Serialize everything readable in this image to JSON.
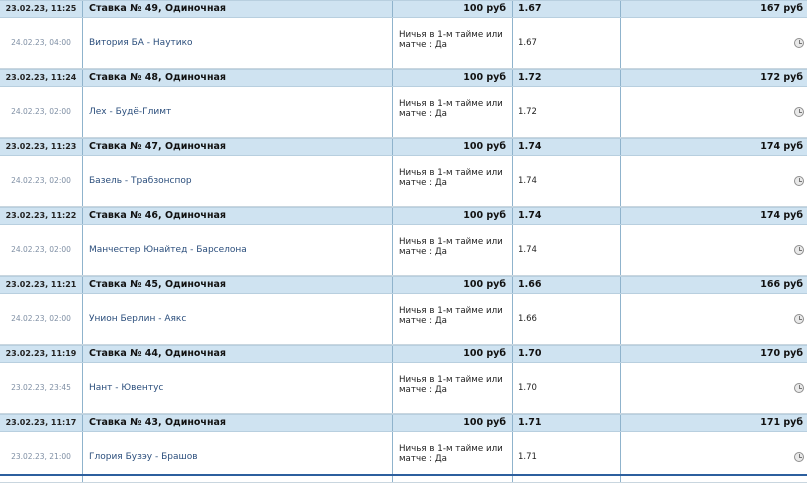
{
  "bets": [
    {
      "placed": "23.02.23, 11:25",
      "title": "Ставка № 49, Одиночная",
      "stake": "100 руб",
      "odds": "1.67",
      "win": "167 руб",
      "match_date": "24.02.23, 04:00",
      "event": "Витория БА - Наутико",
      "outcome": "Ничья в 1-м тайме или матче : Да",
      "event_odds": "1.67",
      "status_icon": "clock-icon"
    },
    {
      "placed": "23.02.23, 11:24",
      "title": "Ставка № 48, Одиночная",
      "stake": "100 руб",
      "odds": "1.72",
      "win": "172 руб",
      "match_date": "24.02.23, 02:00",
      "event": "Лех - Будё-Глимт",
      "outcome": "Ничья в 1-м тайме или матче : Да",
      "event_odds": "1.72",
      "status_icon": "clock-icon"
    },
    {
      "placed": "23.02.23, 11:23",
      "title": "Ставка № 47, Одиночная",
      "stake": "100 руб",
      "odds": "1.74",
      "win": "174 руб",
      "match_date": "24.02.23, 02:00",
      "event": "Базель - Трабзонспор",
      "outcome": "Ничья в 1-м тайме или матче : Да",
      "event_odds": "1.74",
      "status_icon": "clock-icon"
    },
    {
      "placed": "23.02.23, 11:22",
      "title": "Ставка № 46, Одиночная",
      "stake": "100 руб",
      "odds": "1.74",
      "win": "174 руб",
      "match_date": "24.02.23, 02:00",
      "event": "Манчестер Юнайтед - Барселона",
      "outcome": "Ничья в 1-м тайме или матче : Да",
      "event_odds": "1.74",
      "status_icon": "clock-icon"
    },
    {
      "placed": "23.02.23, 11:21",
      "title": "Ставка № 45, Одиночная",
      "stake": "100 руб",
      "odds": "1.66",
      "win": "166 руб",
      "match_date": "24.02.23, 02:00",
      "event": "Унион Берлин - Аякс",
      "outcome": "Ничья в 1-м тайме или матче : Да",
      "event_odds": "1.66",
      "status_icon": "clock-icon"
    },
    {
      "placed": "23.02.23, 11:19",
      "title": "Ставка № 44, Одиночная",
      "stake": "100 руб",
      "odds": "1.70",
      "win": "170 руб",
      "match_date": "23.02.23, 23:45",
      "event": "Нант - Ювентус",
      "outcome": "Ничья в 1-м тайме или матче : Да",
      "event_odds": "1.70",
      "status_icon": "clock-icon"
    },
    {
      "placed": "23.02.23, 11:17",
      "title": "Ставка № 43, Одиночная",
      "stake": "100 руб",
      "odds": "1.71",
      "win": "171 руб",
      "match_date": "23.02.23, 21:00",
      "event": "Глория Бузэу - Брашов",
      "outcome": "Ничья в 1-м тайме или матче : Да",
      "event_odds": "1.71",
      "status_icon": "clock-icon"
    }
  ]
}
